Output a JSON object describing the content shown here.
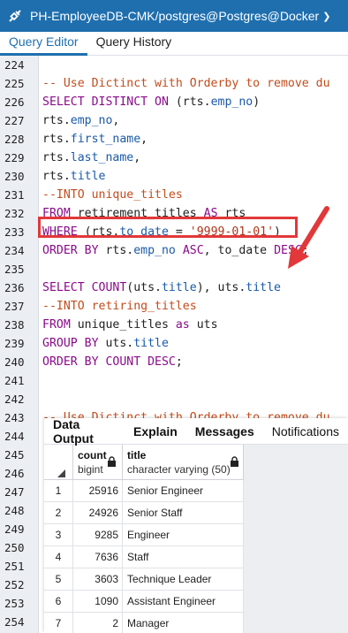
{
  "connection": {
    "label": "PH-EmployeeDB-CMK/postgres@Postgres@Docker",
    "icon": "connection-plug-icon"
  },
  "tabs": [
    {
      "label": "Query Editor",
      "active": true
    },
    {
      "label": "Query History",
      "active": false
    }
  ],
  "editor": {
    "lines": [
      {
        "no": "224",
        "parts": []
      },
      {
        "no": "225",
        "parts": [
          {
            "t": "-- Use Dictinct with Orderby to remove du",
            "c": "cmt"
          }
        ]
      },
      {
        "no": "226",
        "parts": [
          {
            "t": "SELECT DISTINCT ON",
            "c": "kw"
          },
          {
            "t": " (rts.",
            "c": ""
          },
          {
            "t": "emp_no",
            "c": "fld"
          },
          {
            "t": ")",
            "c": ""
          }
        ]
      },
      {
        "no": "227",
        "parts": [
          {
            "t": "rts.",
            "c": ""
          },
          {
            "t": "emp_no",
            "c": "fld"
          },
          {
            "t": ",",
            "c": ""
          }
        ]
      },
      {
        "no": "228",
        "parts": [
          {
            "t": "rts.",
            "c": ""
          },
          {
            "t": "first_name",
            "c": "fld"
          },
          {
            "t": ",",
            "c": ""
          }
        ]
      },
      {
        "no": "229",
        "parts": [
          {
            "t": "rts.",
            "c": ""
          },
          {
            "t": "last_name",
            "c": "fld"
          },
          {
            "t": ",",
            "c": ""
          }
        ]
      },
      {
        "no": "230",
        "parts": [
          {
            "t": "rts.",
            "c": ""
          },
          {
            "t": "title",
            "c": "fld"
          }
        ]
      },
      {
        "no": "231",
        "parts": [
          {
            "t": "--INTO unique_titles",
            "c": "cmt"
          }
        ]
      },
      {
        "no": "232",
        "parts": [
          {
            "t": "FROM",
            "c": "kw"
          },
          {
            "t": " retirement_titles ",
            "c": ""
          },
          {
            "t": "AS",
            "c": "kw"
          },
          {
            "t": " rts",
            "c": ""
          }
        ]
      },
      {
        "no": "233",
        "parts": [
          {
            "t": "WHERE",
            "c": "kw"
          },
          {
            "t": " (rts.",
            "c": ""
          },
          {
            "t": "to_date",
            "c": "fld"
          },
          {
            "t": " = ",
            "c": ""
          },
          {
            "t": "'9999-01-01'",
            "c": "str"
          },
          {
            "t": ")",
            "c": ""
          }
        ]
      },
      {
        "no": "234",
        "parts": [
          {
            "t": "ORDER BY",
            "c": "kw"
          },
          {
            "t": " rts.",
            "c": ""
          },
          {
            "t": "emp_no",
            "c": "fld"
          },
          {
            "t": " ",
            "c": ""
          },
          {
            "t": "ASC",
            "c": "kw"
          },
          {
            "t": ", to_date ",
            "c": ""
          },
          {
            "t": "DESC",
            "c": "kw"
          },
          {
            "t": ";",
            "c": ""
          }
        ]
      },
      {
        "no": "235",
        "parts": []
      },
      {
        "no": "236",
        "parts": [
          {
            "t": "SELECT COUNT",
            "c": "kw"
          },
          {
            "t": "(uts.",
            "c": ""
          },
          {
            "t": "title",
            "c": "fld"
          },
          {
            "t": "), uts.",
            "c": ""
          },
          {
            "t": "title",
            "c": "fld"
          }
        ]
      },
      {
        "no": "237",
        "parts": [
          {
            "t": "--INTO retiring_titles",
            "c": "cmt"
          }
        ]
      },
      {
        "no": "238",
        "parts": [
          {
            "t": "FROM",
            "c": "kw"
          },
          {
            "t": " unique_titles ",
            "c": ""
          },
          {
            "t": "as",
            "c": "kw"
          },
          {
            "t": " uts",
            "c": ""
          }
        ]
      },
      {
        "no": "239",
        "parts": [
          {
            "t": "GROUP BY",
            "c": "kw"
          },
          {
            "t": " uts.",
            "c": ""
          },
          {
            "t": "title",
            "c": "fld"
          }
        ]
      },
      {
        "no": "240",
        "parts": [
          {
            "t": "ORDER BY COUNT DESC",
            "c": "kw"
          },
          {
            "t": ";",
            "c": ""
          }
        ]
      },
      {
        "no": "241",
        "parts": []
      },
      {
        "no": "242",
        "parts": []
      },
      {
        "no": "243",
        "parts": [
          {
            "t": "-- Use Dictinct with Orderby to remove du",
            "c": "cmt"
          }
        ]
      },
      {
        "no": "244",
        "parts": []
      },
      {
        "no": "245",
        "parts": []
      },
      {
        "no": "246",
        "parts": []
      },
      {
        "no": "247",
        "parts": []
      },
      {
        "no": "248",
        "parts": []
      },
      {
        "no": "249",
        "parts": []
      },
      {
        "no": "250",
        "parts": []
      },
      {
        "no": "251",
        "parts": []
      },
      {
        "no": "252",
        "parts": []
      },
      {
        "no": "253",
        "parts": []
      },
      {
        "no": "254",
        "parts": []
      }
    ]
  },
  "annotation": {
    "color": "#e2383a"
  },
  "results": {
    "tabs": [
      {
        "label": "Data Output",
        "bold": true
      },
      {
        "label": "Explain",
        "bold": true
      },
      {
        "label": "Messages",
        "bold": true
      },
      {
        "label": "Notifications",
        "bold": false
      }
    ],
    "columns": [
      {
        "name": "count",
        "type": "bigint"
      },
      {
        "name": "title",
        "type": "character varying (50)"
      }
    ],
    "rows": [
      {
        "n": "1",
        "count": "25916",
        "title": "Senior Engineer"
      },
      {
        "n": "2",
        "count": "24926",
        "title": "Senior Staff"
      },
      {
        "n": "3",
        "count": "9285",
        "title": "Engineer"
      },
      {
        "n": "4",
        "count": "7636",
        "title": "Staff"
      },
      {
        "n": "5",
        "count": "3603",
        "title": "Technique Leader"
      },
      {
        "n": "6",
        "count": "1090",
        "title": "Assistant Engineer"
      },
      {
        "n": "7",
        "count": "2",
        "title": "Manager"
      }
    ]
  }
}
